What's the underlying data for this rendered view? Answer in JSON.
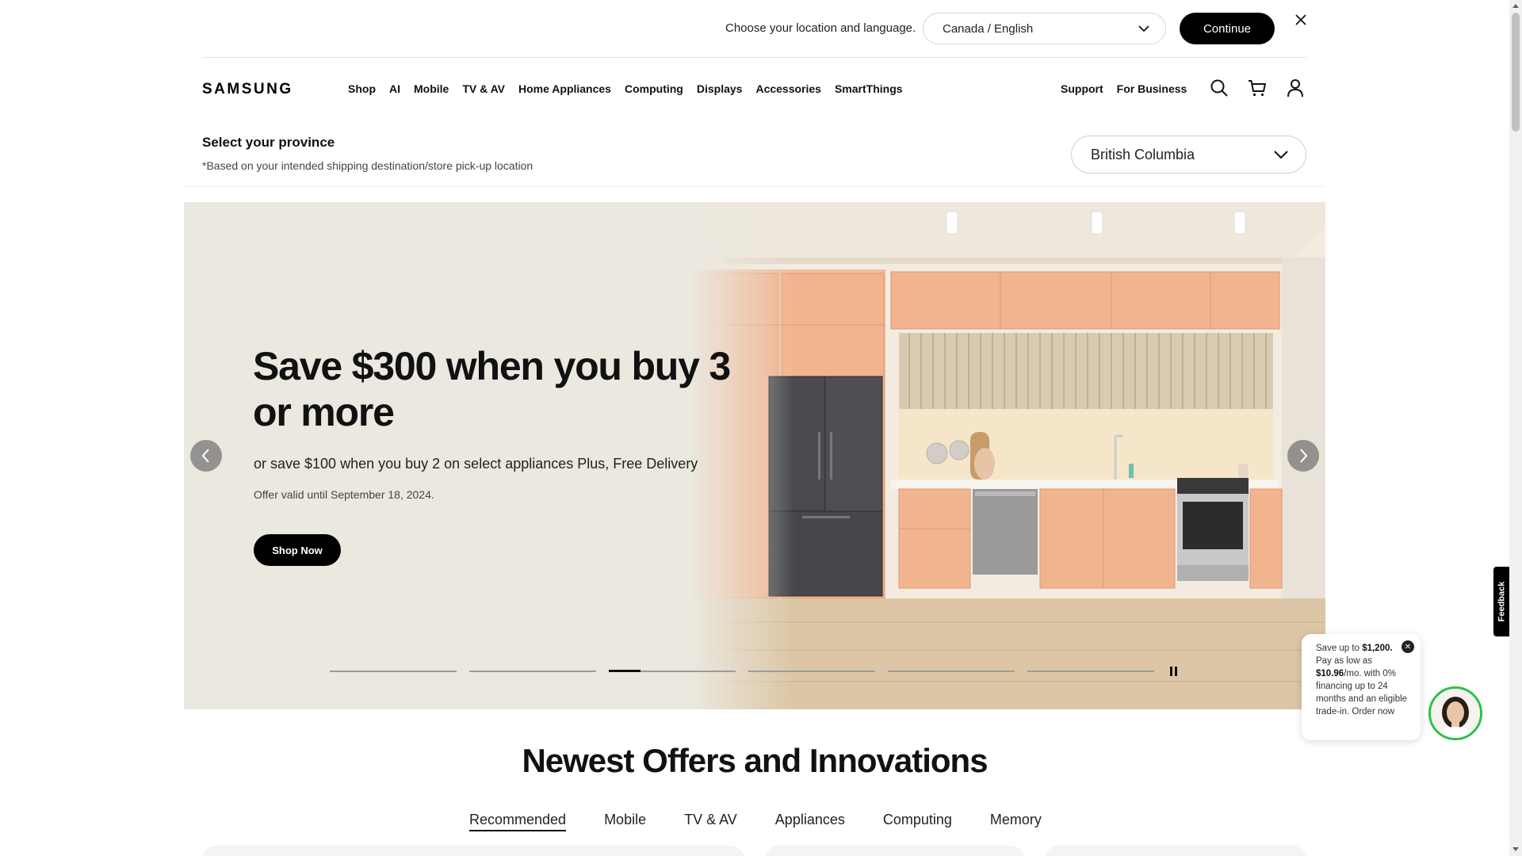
{
  "locale_bar": {
    "prompt": "Choose your location and language.",
    "selected": "Canada / English",
    "continue_label": "Continue",
    "icons": {
      "dropdown": "chevron-down-icon",
      "close": "close-icon"
    }
  },
  "header": {
    "logo": "SAMSUNG",
    "nav": [
      "Shop",
      "AI",
      "Mobile",
      "TV & AV",
      "Home Appliances",
      "Computing",
      "Displays",
      "Accessories",
      "SmartThings"
    ],
    "right_links": [
      "Support",
      "For Business"
    ],
    "icons": [
      "search-icon",
      "cart-icon",
      "user-icon"
    ]
  },
  "province": {
    "title": "Select your province",
    "note": "*Based on your intended shipping destination/store pick-up location",
    "selected": "British Columbia"
  },
  "hero": {
    "headline": "Save $300 when you buy 3 or more",
    "subtext": "or save $100 when you buy 2 on select appliances Plus, Free Delivery",
    "offer_note": "Offer valid until September 18, 2024.",
    "cta": "Shop Now",
    "slide_count": 6,
    "active_slide": 3,
    "colors": {
      "background": "#ebe8df",
      "cabinet": "#f2b48f"
    }
  },
  "offers": {
    "title": "Newest Offers and Innovations",
    "tabs": [
      "Recommended",
      "Mobile",
      "TV & AV",
      "Appliances",
      "Computing",
      "Memory"
    ],
    "active_tab": "Recommended"
  },
  "chat": {
    "line1_pre": "Save up to ",
    "line1_amount": "$1,200.",
    "line2_pre": "Pay as low as ",
    "line2_amount": "$10.96",
    "line2_post": "/mo. with 0% financing up to 24 months and an eligible trade-in.",
    "line3": "Order now"
  },
  "feedback": {
    "label": "Feedback"
  }
}
